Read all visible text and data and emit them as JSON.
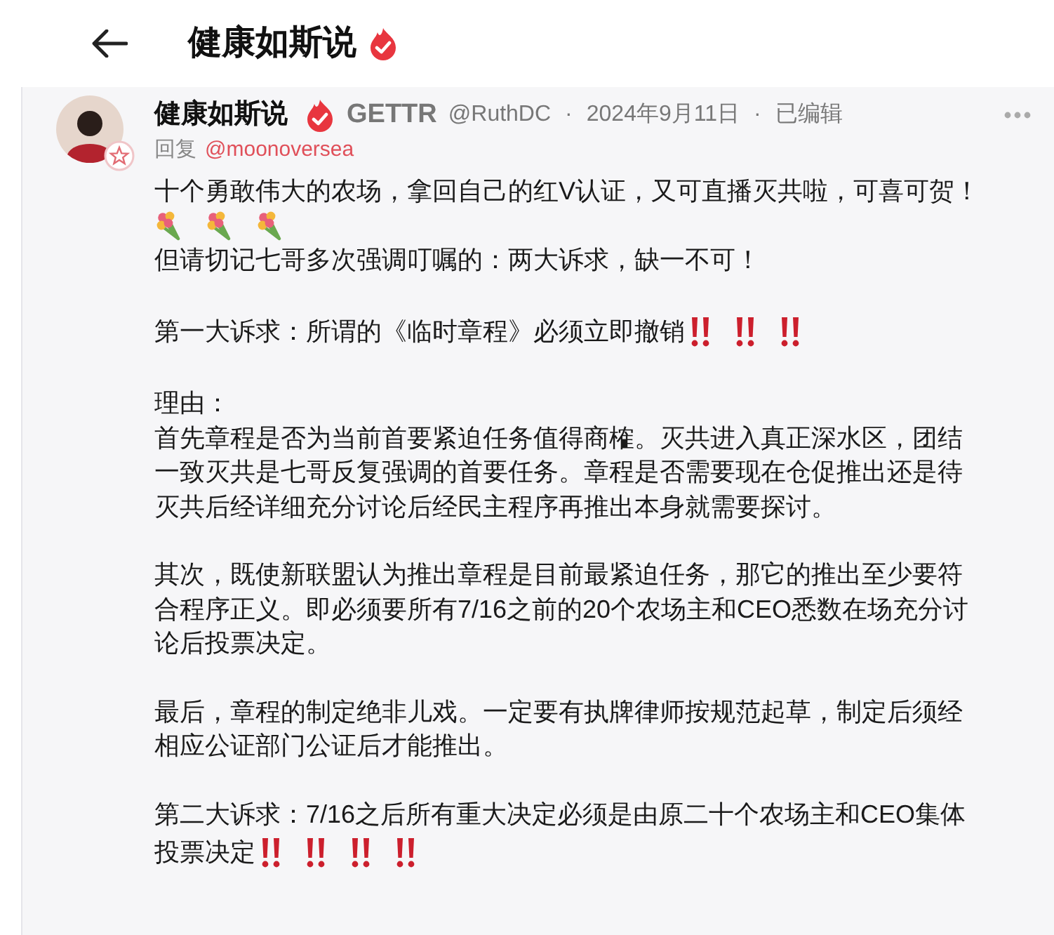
{
  "header": {
    "title": "健康如斯说"
  },
  "post": {
    "author": "健康如斯说",
    "platform": "GETTR",
    "meta": [
      "@RuthDC",
      "·",
      "2024年9月11日",
      "·",
      "已编辑"
    ],
    "reply_label": "回复",
    "reply_to": "@moonoversea",
    "sections": [
      [
        {
          "lines": [
            "十个勇敢伟大的农场，拿回自己的红V认证，又可直播灭共啦，可喜可贺！"
          ]
        },
        {
          "icons": [
            {
              "kind": "bouquet"
            },
            {
              "kind": "bouquet"
            },
            {
              "kind": "bouquet"
            }
          ]
        },
        {
          "lines": [
            "但请切记七哥多次强调叮嘱的：两大诉求，缺一不可！"
          ]
        }
      ],
      [
        {
          "lines": [
            "第一大诉求：所谓的《临时章程》必须立即撤销"
          ],
          "trailing": [
            {
              "kind": "double_exclaim"
            },
            {
              "kind": "double_exclaim"
            },
            {
              "kind": "double_exclaim"
            }
          ]
        }
      ],
      [
        {
          "lines": [
            "理由：",
            "首先章程是否为当前首要紧迫任务值得商榷。灭共进入真正深水区，团结",
            "一致灭共是七哥反复强调的首要任务。章程是否需要现在仓促推出还是待",
            "灭共后经详细充分讨论后经民主程序再推出本身就需要探讨。"
          ]
        }
      ],
      [
        {
          "lines": [
            "其次，既使新联盟认为推出章程是目前最紧迫任务，那它的推出至少要符",
            "合程序正义。即必须要所有7/16之前的20个农场主和CEO悉数在场充分讨",
            "论后投票决定。"
          ]
        }
      ],
      [
        {
          "lines": [
            "最后，章程的制定绝非儿戏。一定要有执牌律师按规范起草，制定后须经",
            "相应公证部门公证后才能推出。"
          ]
        }
      ],
      [
        {
          "lines": [
            "第二大诉求：7/16之后所有重大决定必须是由原二十个农场主和CEO集体",
            "投票决定"
          ],
          "trailing": [
            {
              "kind": "double_exclaim"
            },
            {
              "kind": "double_exclaim"
            },
            {
              "kind": "double_exclaim"
            },
            {
              "kind": "double_exclaim"
            }
          ]
        }
      ]
    ]
  }
}
